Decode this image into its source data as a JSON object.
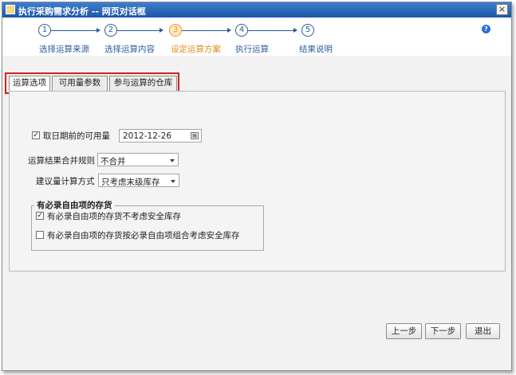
{
  "window": {
    "title": "执行采购需求分析 -- 网页对话框",
    "close_glyph": "×"
  },
  "wizard": {
    "steps": [
      {
        "number": "1",
        "label": "选择运算来源"
      },
      {
        "number": "2",
        "label": "选择运算内容"
      },
      {
        "number": "3",
        "label": "设定运算方案"
      },
      {
        "number": "4",
        "label": "执行运算"
      },
      {
        "number": "5",
        "label": "结果说明"
      }
    ],
    "current_step": 3,
    "help_glyph": "?"
  },
  "tabs": [
    {
      "label": "运算选项",
      "active": true
    },
    {
      "label": "可用量参数",
      "active": false
    },
    {
      "label": "参与运算的仓库",
      "active": false
    }
  ],
  "form": {
    "date_option": {
      "label": "取日期前的可用量",
      "checked": true,
      "value": "2012-12-26"
    },
    "merge_rule": {
      "label": "运算结果合并规则",
      "value": "不合并"
    },
    "suggest_method": {
      "label": "建议量计算方式",
      "value": "只考虑末级库存"
    },
    "free_item_group": {
      "title": "有必录自由项的存货",
      "options": [
        {
          "label": "有必录自由项的存货不考虑安全库存",
          "checked": true
        },
        {
          "label": "有必录自由项的存货按必录自由项组合考虑安全库存",
          "checked": false
        }
      ]
    }
  },
  "buttons": {
    "prev": "上一步",
    "next": "下一步",
    "exit": "退出"
  },
  "colors": {
    "titlebar": "#2a63b8",
    "step": "#2b5d9c",
    "current_step": "#e79a25",
    "highlight": "#d42020"
  }
}
